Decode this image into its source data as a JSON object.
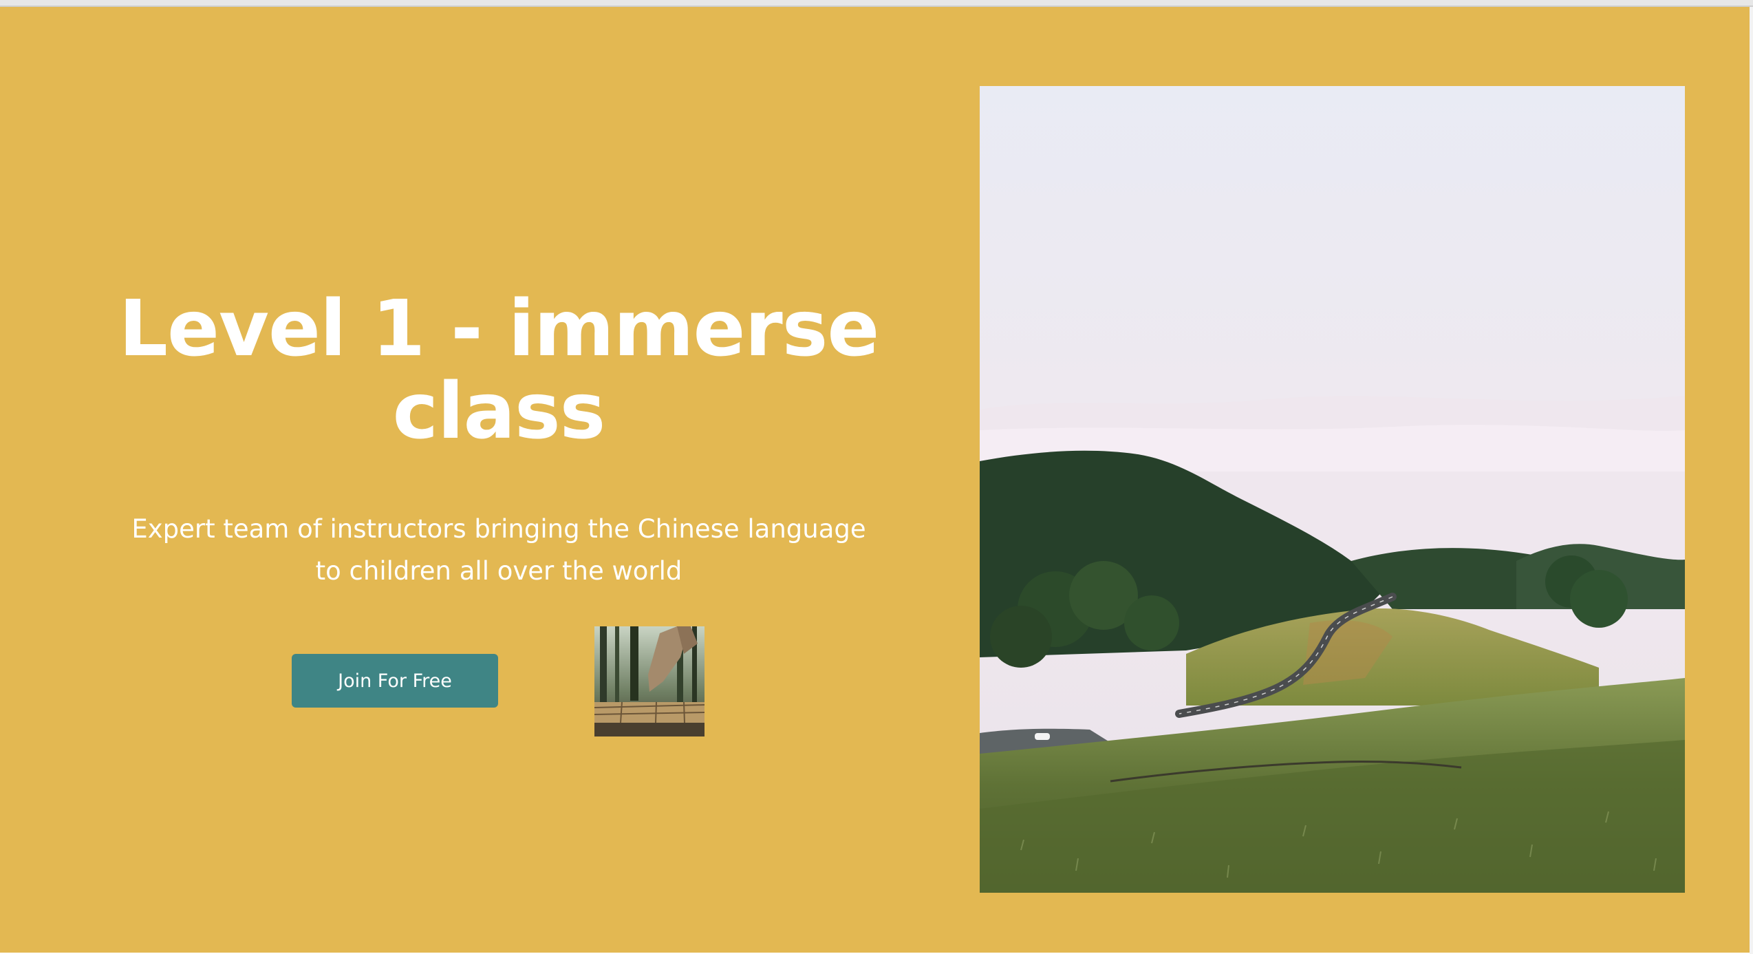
{
  "hero": {
    "title": "Level 1 - immerse class",
    "subtitle": "Expert team of instructors bringing the Chinese language to children all over the world",
    "cta_label": "Join For Free"
  },
  "colors": {
    "hero_background": "#e3b852",
    "button_background": "#3f8585",
    "text": "#ffffff"
  },
  "images": {
    "thumbnail": "forest-boardwalk-photo",
    "main": "misty-hills-winding-road-photo"
  }
}
